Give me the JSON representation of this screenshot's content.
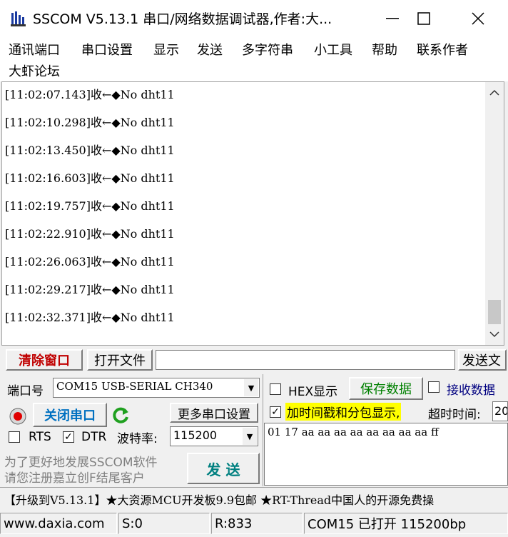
{
  "window": {
    "title": "SSCOM V5.13.1 串口/网络数据调试器,作者:大...",
    "minimize_icon": "minimize-icon",
    "maximize_icon": "maximize-icon",
    "close_icon": "close-icon"
  },
  "menu": {
    "items": [
      "通讯端口",
      "串口设置",
      "显示",
      "发送",
      "多字符串",
      "小工具",
      "帮助",
      "联系作者"
    ],
    "second_row": "大虾论坛"
  },
  "log": {
    "lines": [
      "[11:02:07.143]收←◆No dht11",
      "[11:02:10.298]收←◆No dht11",
      "[11:02:13.450]收←◆No dht11",
      "[11:02:16.603]收←◆No dht11",
      "[11:02:19.757]收←◆No dht11",
      "[11:02:22.910]收←◆No dht11",
      "[11:02:26.063]收←◆No dht11",
      "[11:02:29.217]收←◆No dht11",
      "[11:02:32.371]收←◆No dht11"
    ]
  },
  "toolbar": {
    "clear_window": "清除窗口",
    "open_file": "打开文件",
    "file_path_value": "",
    "send_file": "发送文"
  },
  "port": {
    "port_label": "端口号",
    "port_value": "COM15 USB-SERIAL CH340",
    "close_port": "关闭串口",
    "more_settings": "更多串口设置",
    "rts_label": "RTS",
    "rts_checked": false,
    "dtr_label": "DTR",
    "dtr_checked": true,
    "baud_label": "波特率:",
    "baud_value": "115200",
    "promo_line1": "为了更好地发展SSCOM软件",
    "promo_line2": "请您注册嘉立创F结尾客户",
    "send_button": "发  送"
  },
  "options": {
    "hex_display_label": "HEX显示",
    "hex_display_checked": false,
    "save_data": "保存数据",
    "receive_data_label": "接收数据",
    "receive_data_checked": false,
    "timestamp_label": "加时间戳和分包显示,",
    "timestamp_checked": true,
    "timeout_label": "超时时间:",
    "timeout_value": "20"
  },
  "send_area": {
    "content": "01 17 aa aa aa aa aa aa aa aa ff"
  },
  "banner": {
    "text": "【升级到V5.13.1】★大资源MCU开发板9.9包邮 ★RT-Thread中国人的开源免费操"
  },
  "status": {
    "website": "www.daxia.com",
    "sent": "S:0",
    "received": "R:833",
    "port_status": "COM15 已打开  115200bp"
  },
  "colors": {
    "clear_button_text": "#c00000",
    "close_port_text": "#0070c0",
    "save_button_text": "#008000",
    "send_button_text": "#008080",
    "timestamp_highlight": "#ffff00",
    "receive_label_text": "#000080",
    "refresh_icon": "#20a020"
  }
}
